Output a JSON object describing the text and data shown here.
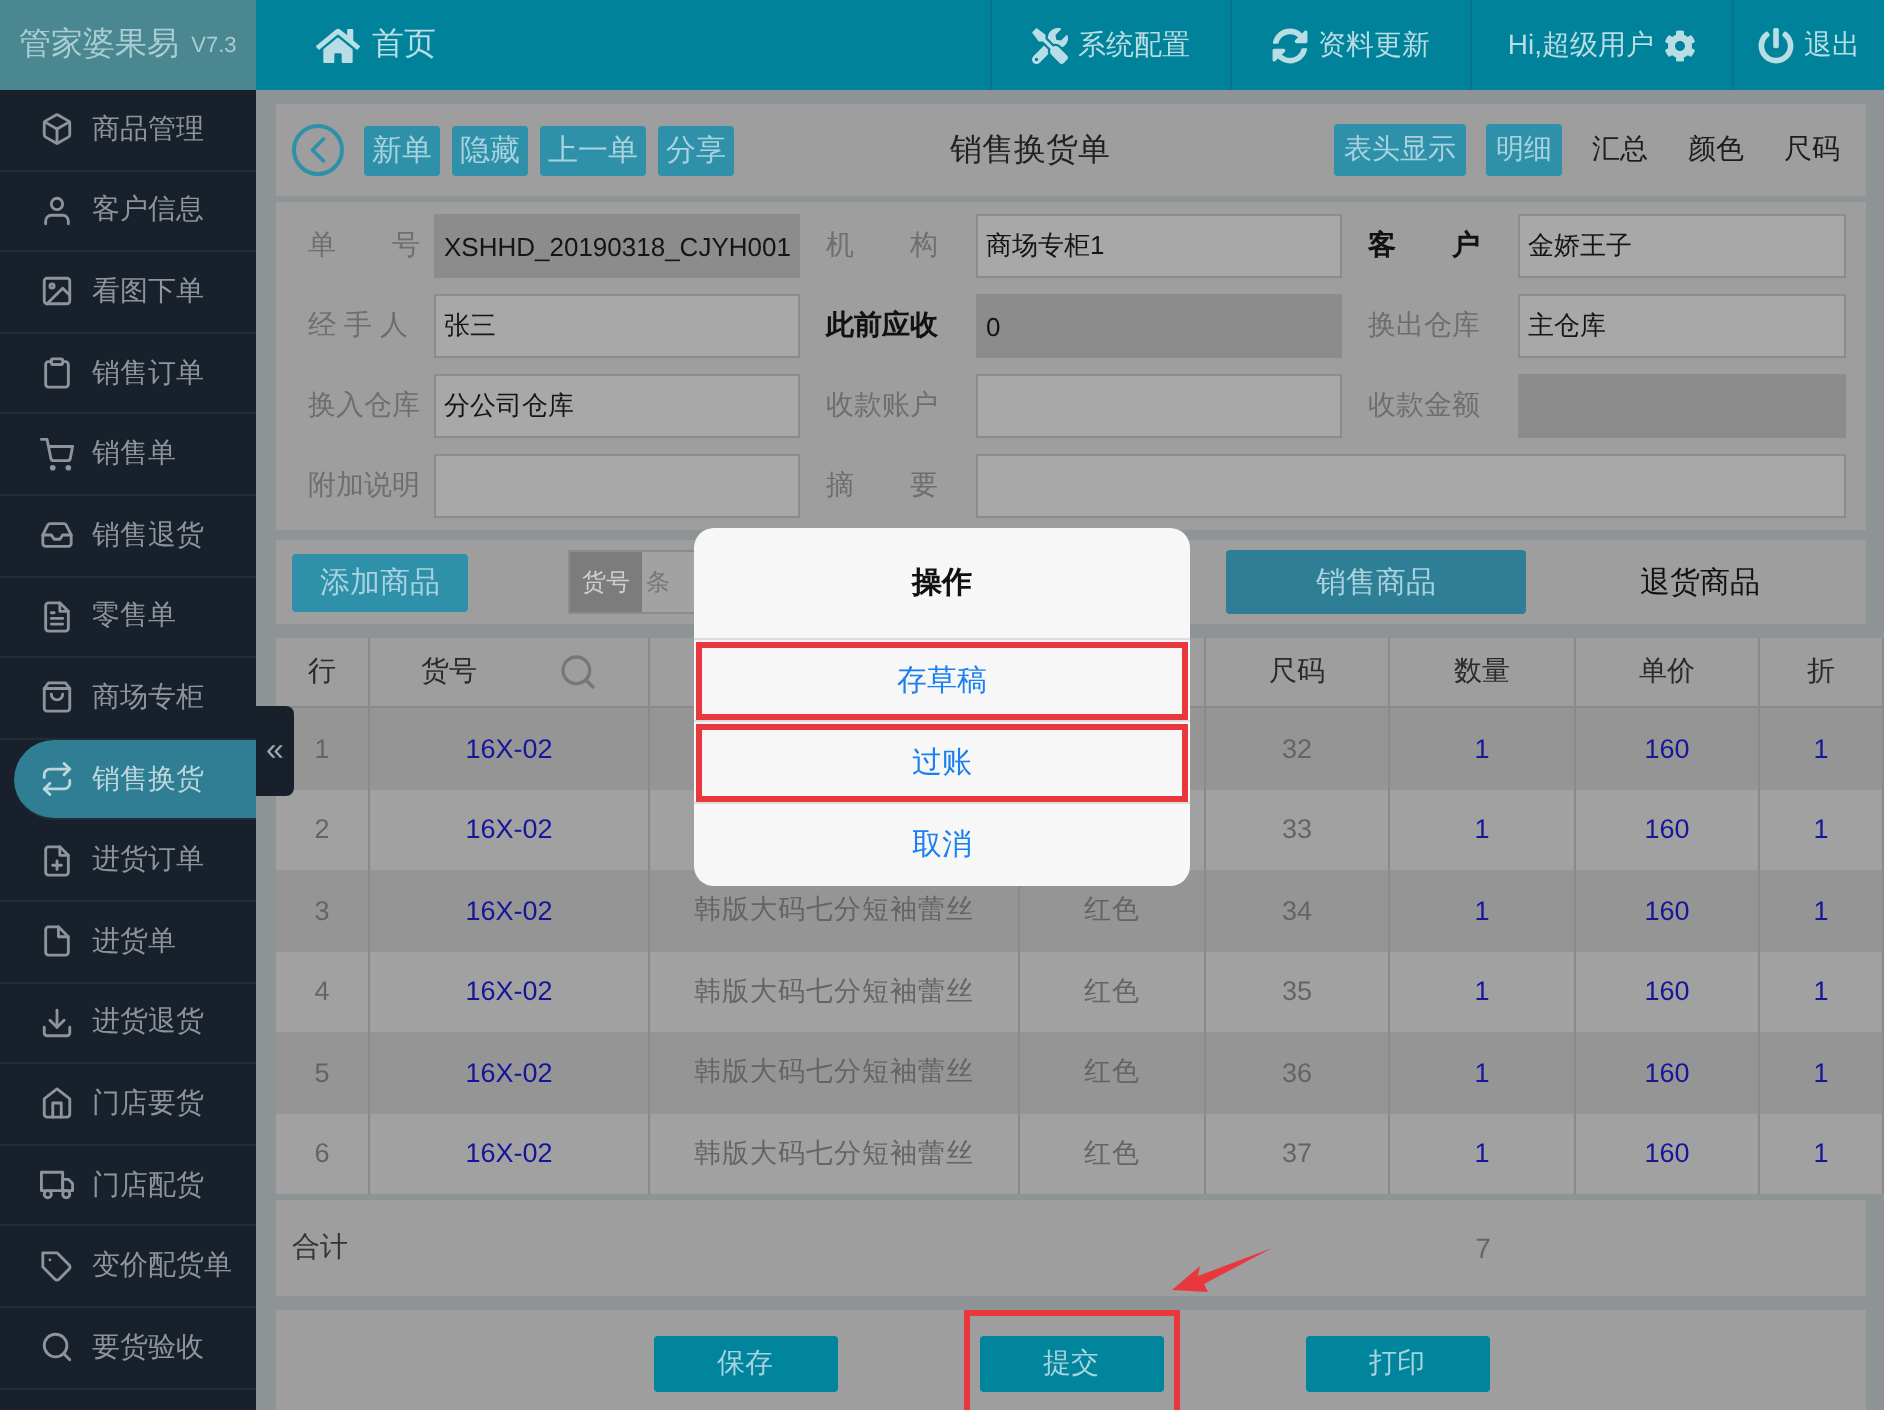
{
  "app": {
    "name": "管家婆果易",
    "version": "V7.3"
  },
  "topbar": {
    "home": "首页",
    "actions": [
      {
        "kind": "tools",
        "label": "系统配置"
      },
      {
        "kind": "refresh",
        "label": "资料更新"
      },
      {
        "kind": "user",
        "label": "Hi,超级用户"
      },
      {
        "kind": "power",
        "label": "退出"
      }
    ]
  },
  "sidebar": {
    "collapse": "«",
    "items": [
      {
        "label": "商品管理",
        "selected": false
      },
      {
        "label": "客户信息",
        "selected": false
      },
      {
        "label": "看图下单",
        "selected": false
      },
      {
        "label": "销售订单",
        "selected": false
      },
      {
        "label": "销售单",
        "selected": false
      },
      {
        "label": "销售退货",
        "selected": false
      },
      {
        "label": "零售单",
        "selected": false
      },
      {
        "label": "商场专柜",
        "selected": false
      },
      {
        "label": "销售换货",
        "selected": true
      },
      {
        "label": "进货订单",
        "selected": false
      },
      {
        "label": "进货单",
        "selected": false
      },
      {
        "label": "进货退货",
        "selected": false
      },
      {
        "label": "门店要货",
        "selected": false
      },
      {
        "label": "门店配货",
        "selected": false
      },
      {
        "label": "变价配货单",
        "selected": false
      },
      {
        "label": "要货验收",
        "selected": false
      }
    ]
  },
  "toolbar": {
    "buttons": [
      "新单",
      "隐藏",
      "上一单",
      "分享"
    ],
    "title": "销售换货单",
    "views": [
      {
        "label": "表头显示",
        "kind": "button"
      },
      {
        "label": "明细",
        "selected": true,
        "kind": "tab"
      },
      {
        "label": "汇总",
        "selected": false,
        "kind": "tab"
      },
      {
        "label": "颜色",
        "selected": false,
        "kind": "tab"
      },
      {
        "label": "尺码",
        "selected": false,
        "kind": "tab"
      }
    ]
  },
  "form": [
    {
      "label": "单　　号",
      "value": "XSHHD_20190318_CJYH001",
      "bold": false,
      "readonly": true
    },
    {
      "label": "机　　构",
      "value": "商场专柜1",
      "bold": false,
      "readonly": false
    },
    {
      "label": "客　　户",
      "value": "金娇王子",
      "bold": true,
      "readonly": false
    },
    {
      "label": "经 手 人",
      "value": "张三",
      "bold": false,
      "readonly": false
    },
    {
      "label": "此前应收",
      "value": "0",
      "bold": true,
      "readonly": true
    },
    {
      "label": "换出仓库",
      "value": "主仓库",
      "bold": false,
      "readonly": false
    },
    {
      "label": "换入仓库",
      "value": "分公司仓库",
      "bold": false,
      "readonly": false
    },
    {
      "label": "收款账户",
      "bold": false,
      "readonly": false
    },
    {
      "label": "收款金额",
      "bold": false,
      "readonly": true
    },
    {
      "label": "附加说明",
      "bold": false,
      "readonly": false
    },
    {
      "label": "摘　　要",
      "bold": false,
      "readonly": false
    }
  ],
  "filter": {
    "add": "添加商品",
    "field_label": "货号",
    "placeholder": "条",
    "tabs": [
      {
        "label": "销售商品",
        "selected": true
      },
      {
        "label": "退货商品",
        "selected": false
      }
    ]
  },
  "table": {
    "columns": [
      "行",
      "货号",
      "",
      "",
      "尺码",
      "数量",
      "单价",
      "折"
    ],
    "rows": [
      {
        "cells": [
          "1",
          "16X-02",
          "",
          "",
          "32",
          "1",
          "160",
          "1"
        ]
      },
      {
        "cells": [
          "2",
          "16X-02",
          "",
          "",
          "33",
          "1",
          "160",
          "1"
        ]
      },
      {
        "cells": [
          "3",
          "16X-02",
          "韩版大码七分短袖蕾丝",
          "红色",
          "34",
          "1",
          "160",
          "1"
        ]
      },
      {
        "cells": [
          "4",
          "16X-02",
          "韩版大码七分短袖蕾丝",
          "红色",
          "35",
          "1",
          "160",
          "1"
        ]
      },
      {
        "cells": [
          "5",
          "16X-02",
          "韩版大码七分短袖蕾丝",
          "红色",
          "36",
          "1",
          "160",
          "1"
        ]
      },
      {
        "cells": [
          "6",
          "16X-02",
          "韩版大码七分短袖蕾丝",
          "红色",
          "37",
          "1",
          "160",
          "1"
        ]
      }
    ],
    "total": {
      "label": "合计",
      "quantity": "7"
    }
  },
  "footer": [
    {
      "label": "保存",
      "highlighted": false
    },
    {
      "label": "提交",
      "highlighted": true
    },
    {
      "label": "打印",
      "highlighted": false
    }
  ],
  "dialog": {
    "title": "操作",
    "actions": [
      {
        "label": "存草稿",
        "highlighted": true
      },
      {
        "label": "过账",
        "highlighted": true
      },
      {
        "label": "取消",
        "highlighted": false
      }
    ]
  }
}
